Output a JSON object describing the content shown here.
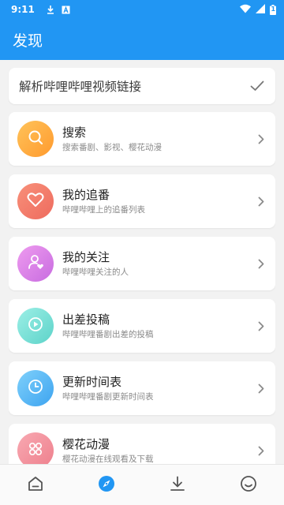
{
  "status_bar": {
    "time": "9:11",
    "battery_text": "1"
  },
  "app_bar": {
    "title": "发现"
  },
  "parse_link": {
    "label": "解析哔哩哔哩视频链接"
  },
  "items": [
    {
      "title": "搜索",
      "subtitle": "搜索番剧、影视、樱花动漫",
      "icon": "search-icon",
      "gradient": [
        "#FFC35A",
        "#FF9A2E"
      ]
    },
    {
      "title": "我的追番",
      "subtitle": "哔哩哔哩上的追番列表",
      "icon": "heart-icon",
      "gradient": [
        "#F8907A",
        "#EE6B5E"
      ]
    },
    {
      "title": "我的关注",
      "subtitle": "哔哩哔哩关注的人",
      "icon": "user-heart-icon",
      "gradient": [
        "#EE9BEF",
        "#C86CE0"
      ]
    },
    {
      "title": "出差投稿",
      "subtitle": "哔哩哔哩番剧出差的投稿",
      "icon": "play-icon",
      "gradient": [
        "#9CEFE6",
        "#5DD3C9"
      ]
    },
    {
      "title": "更新时间表",
      "subtitle": "哔哩哔哩番剧更新时间表",
      "icon": "clock-icon",
      "gradient": [
        "#7FD0FB",
        "#3DA4F0"
      ]
    },
    {
      "title": "樱花动漫",
      "subtitle": "樱花动漫在线观看及下载",
      "icon": "grid-icon",
      "gradient": [
        "#F8A9B2",
        "#EE7F8C"
      ]
    }
  ],
  "bottom_nav": [
    {
      "name": "home-icon",
      "active": false
    },
    {
      "name": "compass-icon",
      "active": true
    },
    {
      "name": "download-icon",
      "active": false
    },
    {
      "name": "smile-icon",
      "active": false
    }
  ],
  "colors": {
    "primary": "#2196F3",
    "chevron": "#8a8a8a",
    "nav_inactive": "#555555"
  }
}
